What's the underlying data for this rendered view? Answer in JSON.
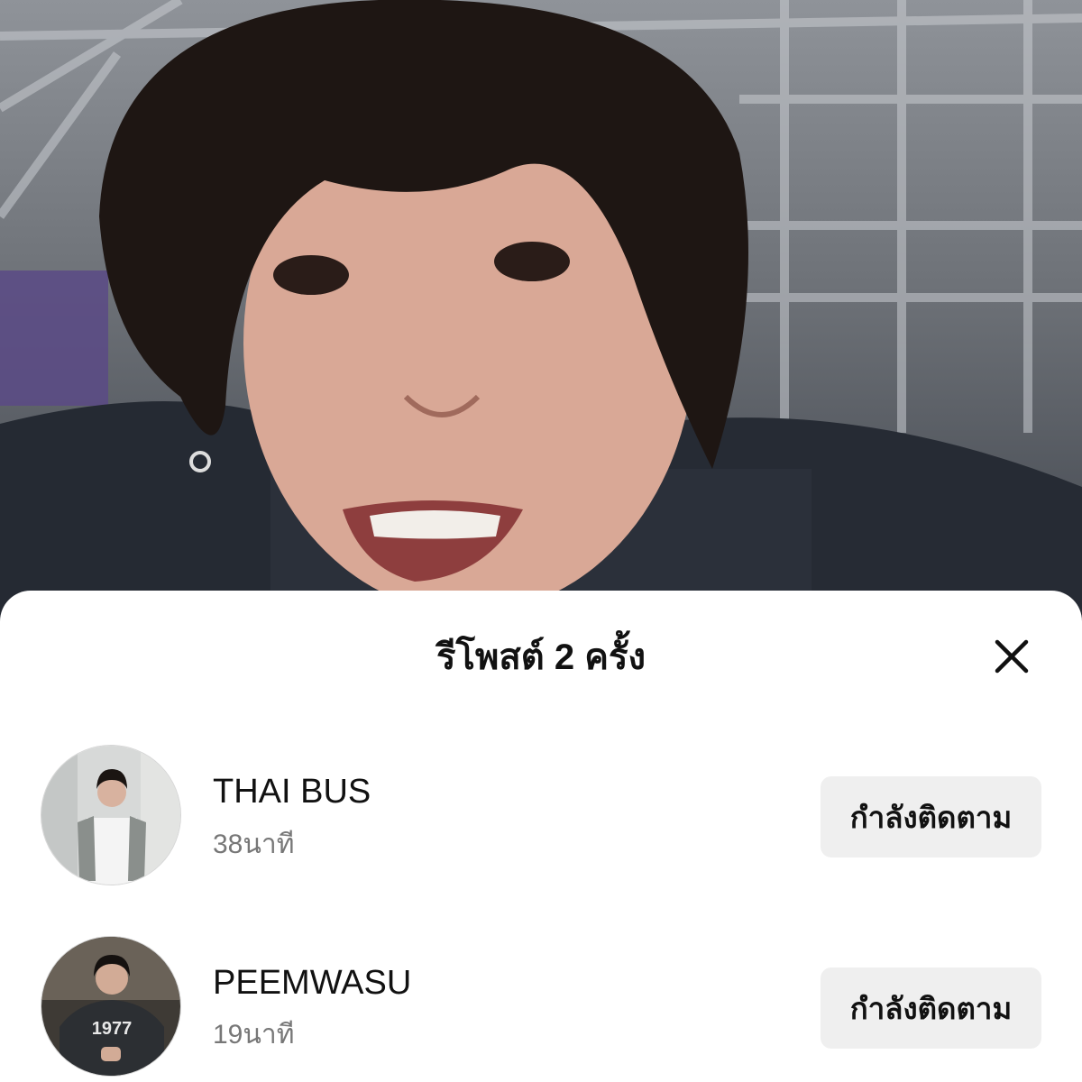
{
  "sheet": {
    "title": "รีโพสต์ 2 ครั้ง",
    "close_icon": "close-icon"
  },
  "reposters": [
    {
      "username": "THAI BUS",
      "time": "38นาที",
      "button_label": "กำลังติดตาม",
      "avatar_icon": "avatar-photo"
    },
    {
      "username": "PEEMWASU",
      "time": "19นาที",
      "button_label": "กำลังติดตาม",
      "avatar_icon": "avatar-photo",
      "shirt_text": "1977"
    }
  ]
}
